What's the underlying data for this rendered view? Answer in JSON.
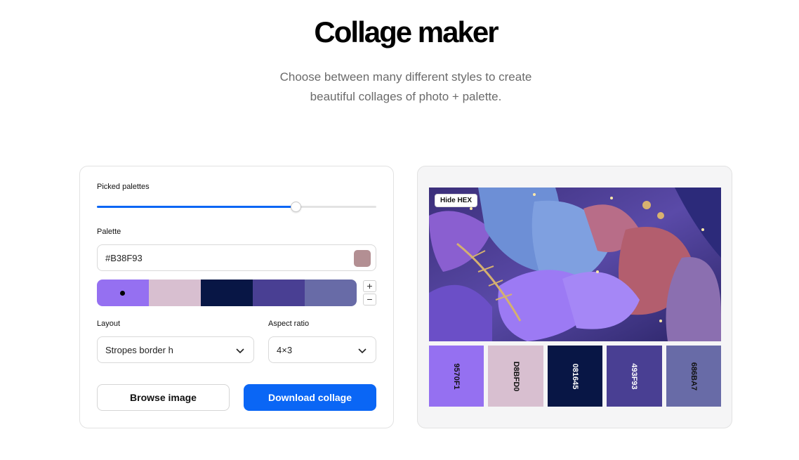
{
  "header": {
    "title": "Collage maker",
    "subtitle_line1": "Choose between many different styles to create",
    "subtitle_line2": "beautiful collages of photo + palette."
  },
  "controls": {
    "picked_palettes_label": "Picked palettes",
    "slider_value": 0.71,
    "palette_label": "Palette",
    "hex_value": "#B38F93",
    "hex_swatch_color": "#B38F93",
    "palette_colors": [
      "#9570F1",
      "#D8BFD0",
      "#081645",
      "#493F93",
      "#686BA7"
    ],
    "selected_swatch_index": 0,
    "plus_label": "+",
    "minus_label": "−",
    "layout_label": "Layout",
    "layout_value": "Stropes border h",
    "aspect_label": "Aspect ratio",
    "aspect_value": "4×3",
    "browse_label": "Browse image",
    "download_label": "Download collage"
  },
  "preview": {
    "hide_hex_label": "Hide HEX",
    "strips": [
      {
        "hex": "9570F1",
        "color": "#9570F1",
        "text_color": "#111111"
      },
      {
        "hex": "D8BFD0",
        "color": "#D8BFD0",
        "text_color": "#111111"
      },
      {
        "hex": "081645",
        "color": "#081645",
        "text_color": "#ffffff"
      },
      {
        "hex": "493F93",
        "color": "#493F93",
        "text_color": "#ffffff"
      },
      {
        "hex": "686BA7",
        "color": "#686BA7",
        "text_color": "#111111"
      }
    ]
  },
  "colors": {
    "accent": "#0a66f5"
  }
}
